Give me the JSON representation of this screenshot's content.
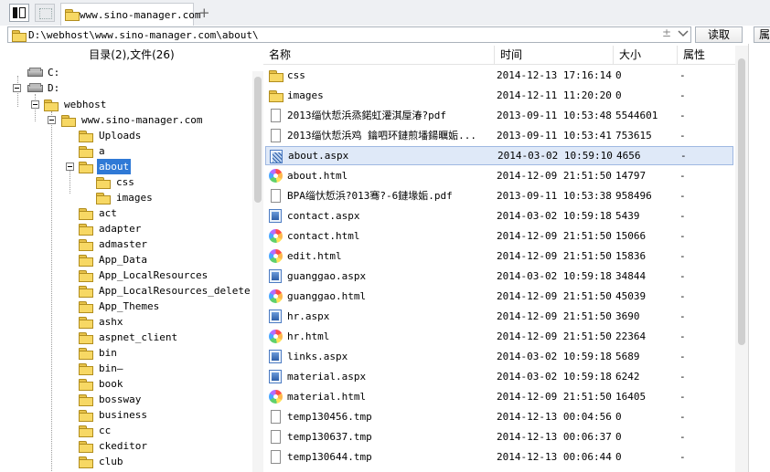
{
  "tab": {
    "title": "www.sino-manager.com"
  },
  "address": {
    "path": "D:\\webhost\\www.sino-manager.com\\about\\",
    "plus": "±",
    "read_label": "读取",
    "attr_label": "属"
  },
  "tree": {
    "header": "目录(2),文件(26)",
    "nodes": [
      {
        "label": "C:"
      },
      {
        "label": "D:"
      },
      {
        "label": "webhost"
      },
      {
        "label": "www.sino-manager.com"
      },
      {
        "label": "Uploads"
      },
      {
        "label": "a"
      },
      {
        "label": "about"
      },
      {
        "label": "css"
      },
      {
        "label": "images"
      },
      {
        "label": "act"
      },
      {
        "label": "adapter"
      },
      {
        "label": "admaster"
      },
      {
        "label": "App_Data"
      },
      {
        "label": "App_LocalResources"
      },
      {
        "label": "App_LocalResources_delete"
      },
      {
        "label": "App_Themes"
      },
      {
        "label": "ashx"
      },
      {
        "label": "aspnet_client"
      },
      {
        "label": "bin"
      },
      {
        "label": "bin—"
      },
      {
        "label": "book"
      },
      {
        "label": "bossway"
      },
      {
        "label": "business"
      },
      {
        "label": "cc"
      },
      {
        "label": "ckeditor"
      },
      {
        "label": "club"
      }
    ]
  },
  "list": {
    "columns": [
      "名称",
      "时间",
      "大小",
      "属性"
    ],
    "rows": [
      {
        "icon": "folder",
        "name": "css",
        "time": "2014-12-13 17:16:14",
        "size": "0",
        "attr": "-"
      },
      {
        "icon": "folder",
        "name": "images",
        "time": "2014-12-11 11:20:20",
        "size": "0",
        "attr": "-"
      },
      {
        "icon": "doc",
        "name": "2013缁忕悊浜烝鍩虹灌淇垕湷?pdf",
        "time": "2013-09-11 10:53:48",
        "size": "5544601",
        "attr": "-"
      },
      {
        "icon": "doc",
        "name": "2013缁忕悊浜鸡  鑰呬环鏈煎墦鍚曞姤...",
        "time": "2013-09-11 10:53:41",
        "size": "753615",
        "attr": "-"
      },
      {
        "icon": "aspx-hatched",
        "name": "about.aspx",
        "time": "2014-03-02 10:59:10",
        "size": "4656",
        "attr": "-"
      },
      {
        "icon": "html",
        "name": "about.html",
        "time": "2014-12-09 21:51:50",
        "size": "14797",
        "attr": "-"
      },
      {
        "icon": "doc",
        "name": "BPA缁忕悊浜?013骞?-6鏈堟姤.pdf",
        "time": "2013-09-11 10:53:38",
        "size": "958496",
        "attr": "-"
      },
      {
        "icon": "aspx",
        "name": "contact.aspx",
        "time": "2014-03-02 10:59:18",
        "size": "5439",
        "attr": "-"
      },
      {
        "icon": "html",
        "name": "contact.html",
        "time": "2014-12-09 21:51:50",
        "size": "15066",
        "attr": "-"
      },
      {
        "icon": "html",
        "name": "edit.html",
        "time": "2014-12-09 21:51:50",
        "size": "15836",
        "attr": "-"
      },
      {
        "icon": "aspx",
        "name": "guanggao.aspx",
        "time": "2014-03-02 10:59:18",
        "size": "34844",
        "attr": "-"
      },
      {
        "icon": "html",
        "name": "guanggao.html",
        "time": "2014-12-09 21:51:50",
        "size": "45039",
        "attr": "-"
      },
      {
        "icon": "aspx",
        "name": "hr.aspx",
        "time": "2014-12-09 21:51:50",
        "size": "3690",
        "attr": "-"
      },
      {
        "icon": "html",
        "name": "hr.html",
        "time": "2014-12-09 21:51:50",
        "size": "22364",
        "attr": "-"
      },
      {
        "icon": "aspx",
        "name": "links.aspx",
        "time": "2014-03-02 10:59:18",
        "size": "5689",
        "attr": "-"
      },
      {
        "icon": "aspx",
        "name": "material.aspx",
        "time": "2014-03-02 10:59:18",
        "size": "6242",
        "attr": "-"
      },
      {
        "icon": "html",
        "name": "material.html",
        "time": "2014-12-09 21:51:50",
        "size": "16405",
        "attr": "-"
      },
      {
        "icon": "doc",
        "name": "temp130456.tmp",
        "time": "2014-12-13 00:04:56",
        "size": "0",
        "attr": "-"
      },
      {
        "icon": "doc",
        "name": "temp130637.tmp",
        "time": "2014-12-13 00:06:37",
        "size": "0",
        "attr": "-"
      },
      {
        "icon": "doc",
        "name": "temp130644.tmp",
        "time": "2014-12-13 00:06:44",
        "size": "0",
        "attr": "-"
      }
    ]
  }
}
